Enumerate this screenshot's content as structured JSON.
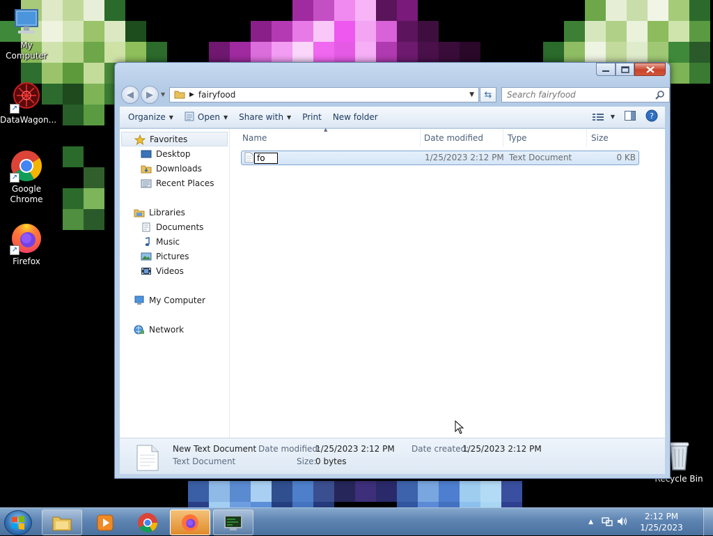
{
  "desktop": {
    "icons": [
      {
        "label": "My Computer"
      },
      {
        "label": "DataWagon..."
      },
      {
        "label": "Google Chrome"
      },
      {
        "label": "Firefox"
      },
      {
        "label": "Recycle Bin"
      }
    ]
  },
  "window": {
    "address": {
      "folder": "fairyfood"
    },
    "search": {
      "placeholder": "Search fairyfood"
    },
    "toolbar": {
      "organize": "Organize",
      "open": "Open",
      "share_with": "Share with",
      "print": "Print",
      "new_folder": "New folder"
    },
    "nav": {
      "favorites": "Favorites",
      "desktop": "Desktop",
      "downloads": "Downloads",
      "recent_places": "Recent Places",
      "libraries": "Libraries",
      "documents": "Documents",
      "music": "Music",
      "pictures": "Pictures",
      "videos": "Videos",
      "my_computer": "My Computer",
      "network": "Network"
    },
    "columns": {
      "name": "Name",
      "date_modified": "Date modified",
      "type": "Type",
      "size": "Size"
    },
    "files": [
      {
        "rename_text": "fo",
        "date_modified": "1/25/2023 2:12 PM",
        "type": "Text Document",
        "size": "0 KB"
      }
    ],
    "details": {
      "name": "New Text Document",
      "type": "Text Document",
      "date_modified_label": "Date modified:",
      "date_modified": "1/25/2023 2:12 PM",
      "size_label": "Size:",
      "size": "0 bytes",
      "date_created_label": "Date created:",
      "date_created": "1/25/2023 2:12 PM"
    }
  },
  "taskbar": {
    "clock_time": "2:12 PM",
    "clock_date": "1/25/2023"
  },
  "colors": {
    "window_frame": "#c6daf0",
    "selection": "#d4e5f8",
    "close_button": "#c9442b",
    "taskbar": "#5d84b2"
  }
}
